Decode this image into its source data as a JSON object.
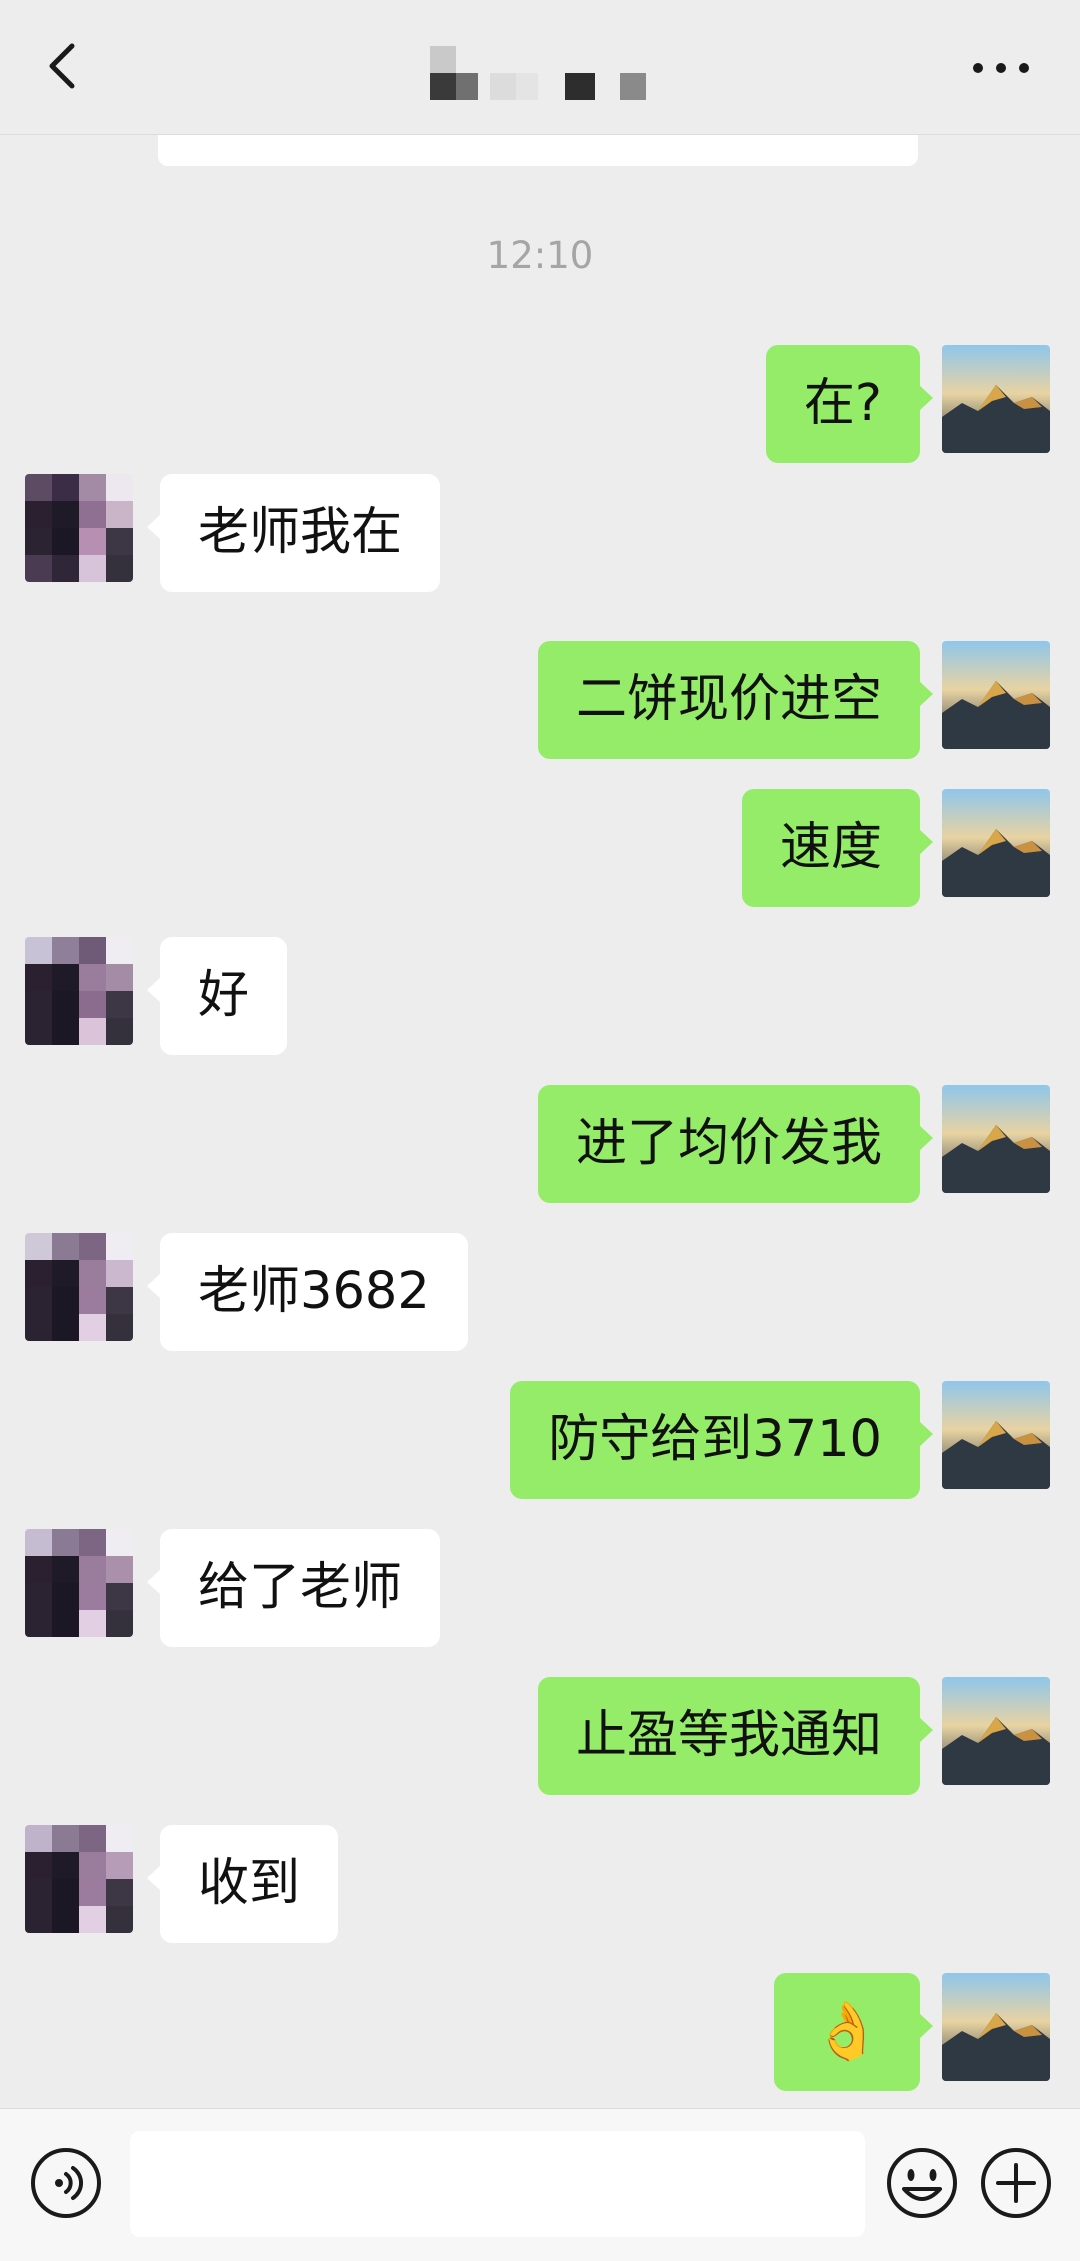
{
  "header": {
    "title_display": "pixelated"
  },
  "timestamp": "12:10",
  "messages": [
    {
      "from": "me",
      "text": "在?"
    },
    {
      "from": "other",
      "text": "老师我在"
    },
    {
      "from": "me",
      "text": "二饼现价进空"
    },
    {
      "from": "me",
      "text": "速度"
    },
    {
      "from": "other",
      "text": "好"
    },
    {
      "from": "me",
      "text": "进了均价发我"
    },
    {
      "from": "other",
      "text": "老师3682"
    },
    {
      "from": "me",
      "text": "防守给到3710"
    },
    {
      "from": "other",
      "text": "给了老师"
    },
    {
      "from": "me",
      "text": "止盈等我通知"
    },
    {
      "from": "other",
      "text": "收到"
    },
    {
      "from": "me",
      "text": "👌"
    }
  ],
  "input": {
    "value": "",
    "placeholder": ""
  },
  "icons": {
    "back": "back-arrow-icon",
    "more": "more-dots-icon",
    "voice": "voice-icon",
    "emoji": "emoji-icon",
    "plus": "plus-icon"
  },
  "colors": {
    "background": "#ededed",
    "my_bubble": "#95ec69",
    "other_bubble": "#ffffff",
    "timestamp": "#a5a5a5"
  }
}
